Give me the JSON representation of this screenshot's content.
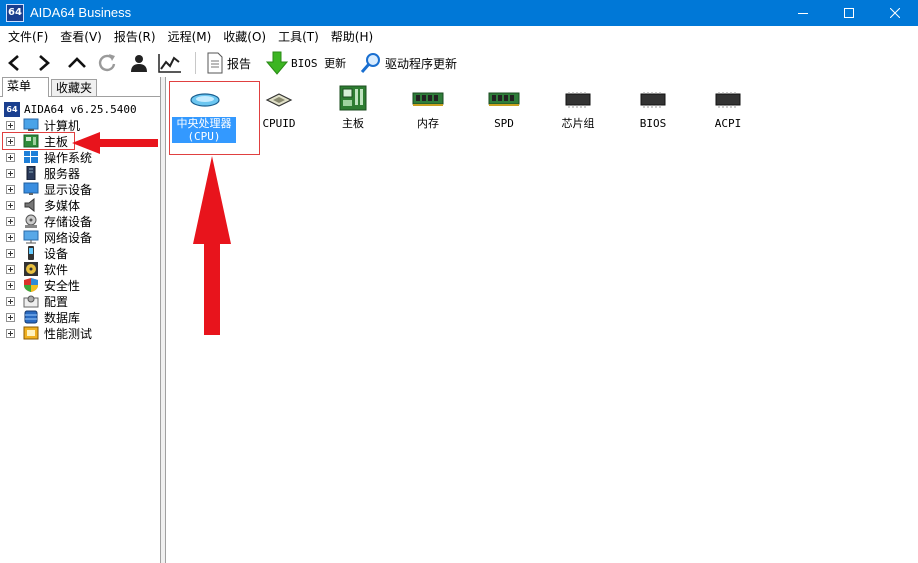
{
  "window": {
    "icon_text": "64",
    "title": "AIDA64 Business"
  },
  "menu": [
    "文件(F)",
    "查看(V)",
    "报告(R)",
    "远程(M)",
    "收藏(O)",
    "工具(T)",
    "帮助(H)"
  ],
  "toolbar": {
    "report_label": "报告",
    "bios_update_label": "BIOS 更新",
    "driver_update_label": "驱动程序更新"
  },
  "tabs": [
    "菜单",
    "收藏夹"
  ],
  "tree": {
    "root_label": "AIDA64 v6.25.5400",
    "items": [
      "计算机",
      "主板",
      "操作系统",
      "服务器",
      "显示设备",
      "多媒体",
      "存储设备",
      "网络设备",
      "设备",
      "软件",
      "安全性",
      "配置",
      "数据库",
      "性能测试"
    ]
  },
  "main_items": [
    {
      "label_line1": "中央处理器",
      "label_line2": "(CPU)",
      "icon": "cpu-icon"
    },
    {
      "label_line1": "CPUID",
      "label_line2": "",
      "icon": "cpuid-chip-icon"
    },
    {
      "label_line1": "主板",
      "label_line2": "",
      "icon": "motherboard-icon"
    },
    {
      "label_line1": "内存",
      "label_line2": "",
      "icon": "memory-module-icon"
    },
    {
      "label_line1": "SPD",
      "label_line2": "",
      "icon": "spd-module-icon"
    },
    {
      "label_line1": "芯片组",
      "label_line2": "",
      "icon": "chipset-icon"
    },
    {
      "label_line1": "BIOS",
      "label_line2": "",
      "icon": "bios-chip-icon"
    },
    {
      "label_line1": "ACPI",
      "label_line2": "",
      "icon": "acpi-chip-icon"
    }
  ],
  "colors": {
    "titlebar": "#0078d7",
    "selection": "#3399ff",
    "annotation_arrow": "#e8141c"
  }
}
